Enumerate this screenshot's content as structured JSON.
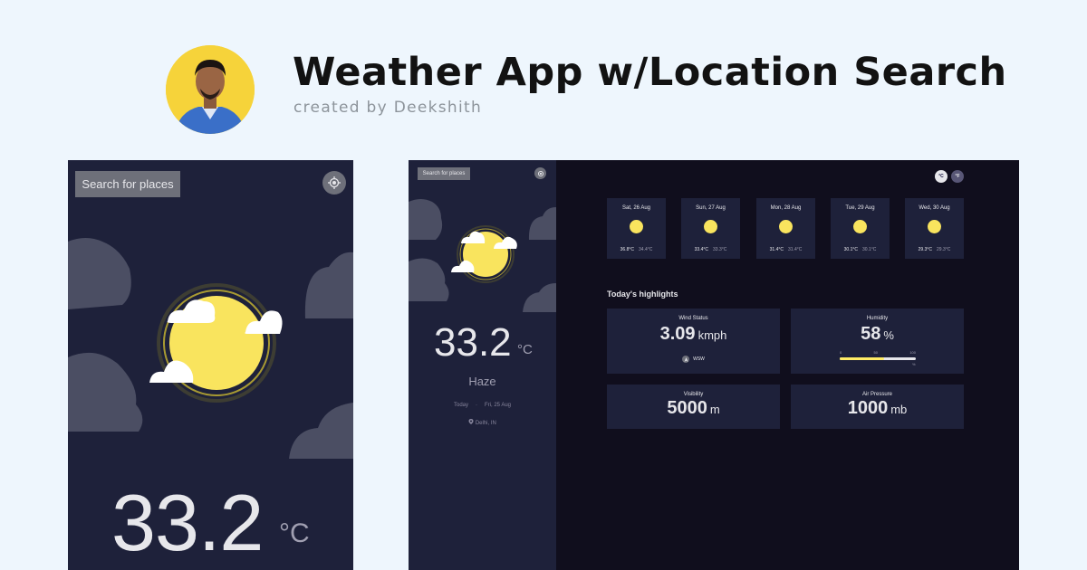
{
  "header": {
    "title": "Weather App w/Location Search",
    "subtitle": "created by Deekshith"
  },
  "colors": {
    "page_bg": "#eef6fd",
    "sidebar_bg": "#1e213a",
    "main_bg": "#100e1d",
    "sun": "#f9e45e",
    "button_bg": "#6e707a",
    "text_light": "#e7e7eb"
  },
  "mobile": {
    "search_label": "Search for places",
    "location_icon": "crosshair-icon",
    "temperature": "33.2",
    "unit": "°C"
  },
  "desktop": {
    "sidebar": {
      "search_label": "Search for places",
      "location_icon": "crosshair-icon",
      "temperature": "33.2",
      "unit": "°C",
      "condition": "Haze",
      "today_label": "Today",
      "separator": "·",
      "date": "Fri, 25 Aug",
      "location": "Delhi, IN"
    },
    "units": {
      "celsius": "°C",
      "fahrenheit": "°F"
    },
    "forecast": [
      {
        "day": "Sat, 26 Aug",
        "high": "36.8°C",
        "low": "34.4°C"
      },
      {
        "day": "Sun, 27 Aug",
        "high": "33.4°C",
        "low": "33.3°C"
      },
      {
        "day": "Mon, 28 Aug",
        "high": "31.4°C",
        "low": "31.4°C"
      },
      {
        "day": "Tue, 29 Aug",
        "high": "30.1°C",
        "low": "30.1°C"
      },
      {
        "day": "Wed, 30 Aug",
        "high": "29.3°C",
        "low": "29.3°C"
      }
    ],
    "highlights": {
      "title": "Today's highlights",
      "wind": {
        "label": "Wind Status",
        "value": "3.09",
        "unit": "kmph",
        "direction": "WSW"
      },
      "humidity": {
        "label": "Humidity",
        "value": "58",
        "unit": "%",
        "scale": [
          "0",
          "50",
          "100"
        ],
        "percent_sign": "%",
        "level": 0.58
      },
      "visibility": {
        "label": "Visibility",
        "value": "5000",
        "unit": "m"
      },
      "pressure": {
        "label": "Air Pressure",
        "value": "1000",
        "unit": "mb"
      }
    }
  }
}
